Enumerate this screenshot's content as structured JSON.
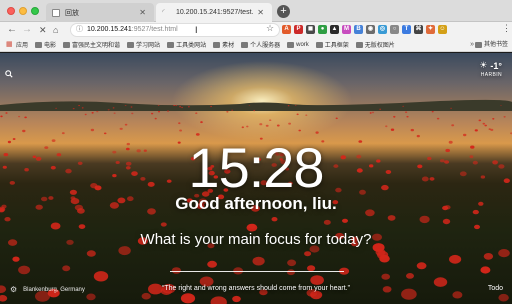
{
  "window": {
    "tabs": [
      {
        "label": "回放",
        "active": false
      },
      {
        "label": "10.200.15.241:9527/test.html",
        "active": true
      }
    ],
    "new_tab_label": "+"
  },
  "toolbar": {
    "url_host": "10.200.15.241",
    "url_rest": ":9527/test.html"
  },
  "bookmarks": {
    "items": [
      "应用",
      "电影",
      "富强民主文明和谐",
      "学习网站",
      "工具类网站",
      "素材",
      "个人服务器",
      "work",
      "工具框架",
      "无版权图片"
    ],
    "more": "»",
    "other": "其他书签"
  },
  "page": {
    "time": "15:28",
    "greeting": "Good afternoon, liu.",
    "question": "What is your main focus for today?",
    "quote": "“The right and wrong answers should come from your heart.”",
    "location": "Blankenburg, Germany",
    "todo": "Todo",
    "weather": {
      "temp": "-1°",
      "city": "HARBIN"
    }
  },
  "colors": {
    "accent_sun": "#ffd98a",
    "poppy_red": "#d4261a"
  }
}
